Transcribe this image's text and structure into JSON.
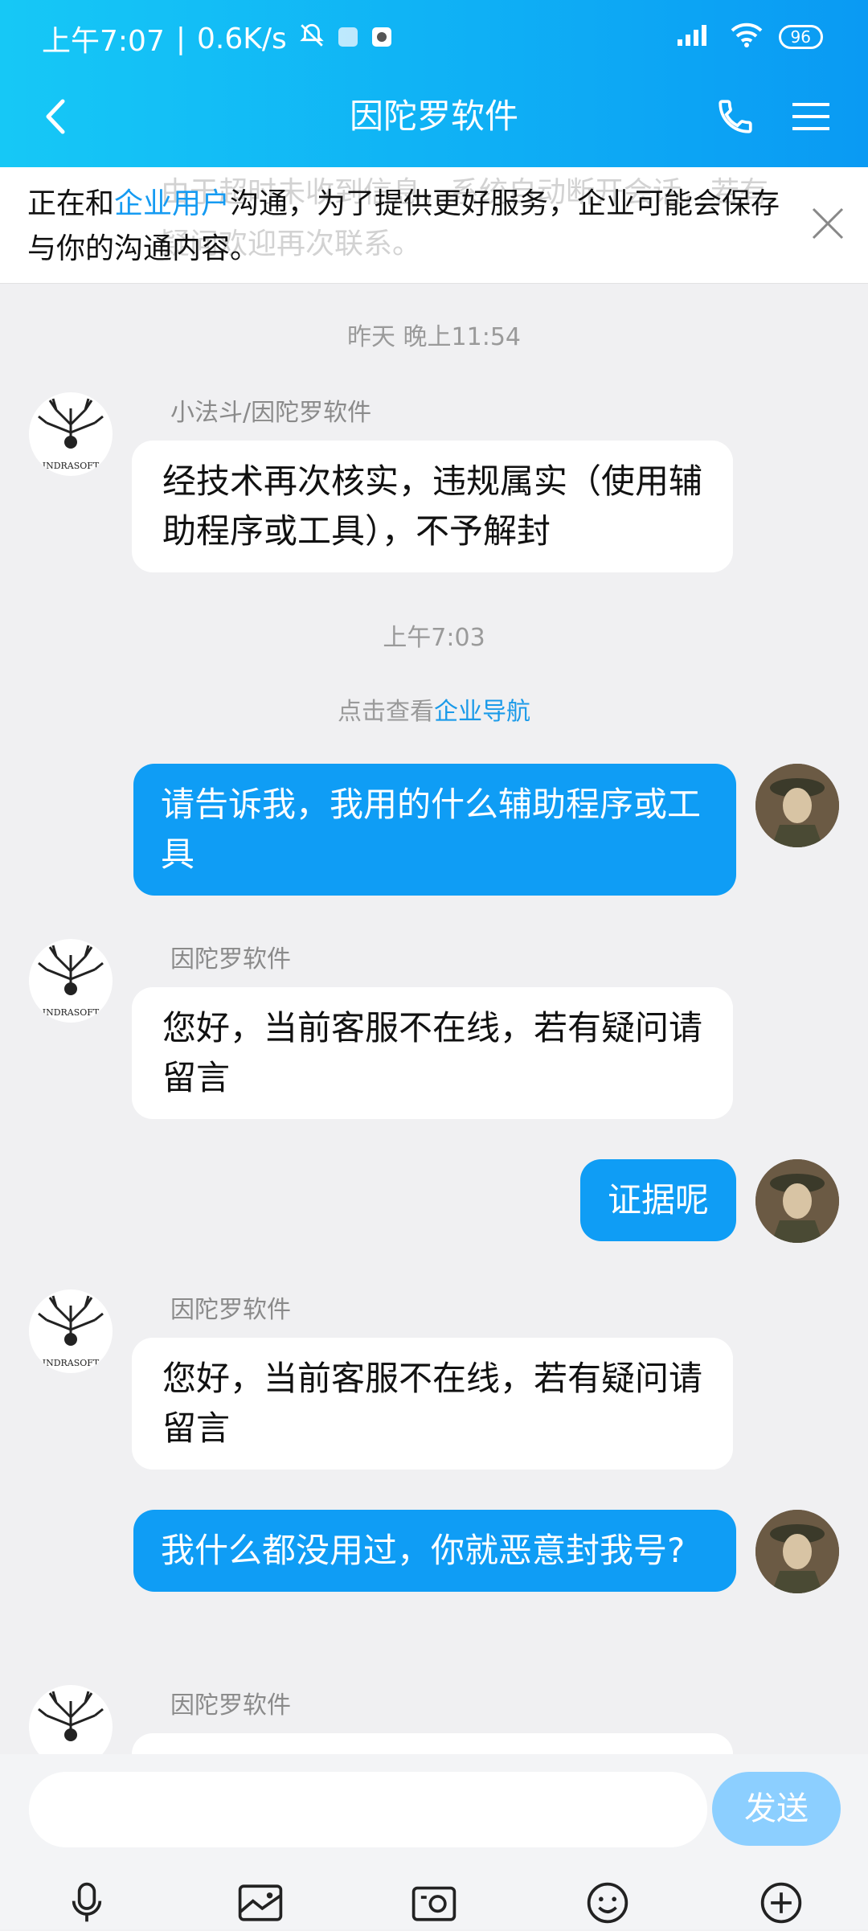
{
  "status": {
    "time": "上午7:07",
    "speed": "0.6K/s",
    "battery": "96"
  },
  "header": {
    "title": "因陀罗软件"
  },
  "notice": {
    "ghost_text": "由于超时未收到信息，系统自动断开会话，若有疑问欢迎再次联系。",
    "prefix": "正在和",
    "link": "企业用户",
    "suffix": "沟通，为了提供更好服务，企业可能会保存与你的沟通内容。"
  },
  "chat": {
    "time1": "昨天 晚上11:54",
    "msg1_sender": "小法斗/因陀罗软件",
    "msg1_text": "经技术再次核实，违规属实（使用辅助程序或工具），不予解封",
    "time2": "上午7:03",
    "sys_prefix": "点击查看",
    "sys_link": "企业导航",
    "msg2_text": "请告诉我，我用的什么辅助程序或工具",
    "msg3_sender": "因陀罗软件",
    "msg3_text": "您好，当前客服不在线，若有疑问请留言",
    "msg4_text": "证据呢",
    "msg5_sender": "因陀罗软件",
    "msg5_text": "您好，当前客服不在线，若有疑问请留言",
    "msg6_text": "我什么都没用过，你就恶意封我号?",
    "msg7_sender": "因陀罗软件",
    "avatar_logo_text": "INDRASOFT"
  },
  "input": {
    "send_label": "发送"
  },
  "icons": {
    "back": "chevron-left-icon",
    "call": "phone-icon",
    "menu": "hamburger-icon",
    "close": "close-icon",
    "mic": "mic-icon",
    "image": "image-icon",
    "camera": "camera-icon",
    "emoji": "emoji-icon",
    "plus": "plus-icon"
  },
  "colors": {
    "header_start": "#16c8f6",
    "header_end": "#0a9af3",
    "bubble_mine": "#0f9df5",
    "send_button": "#8ccfff",
    "link": "#159bf2"
  }
}
